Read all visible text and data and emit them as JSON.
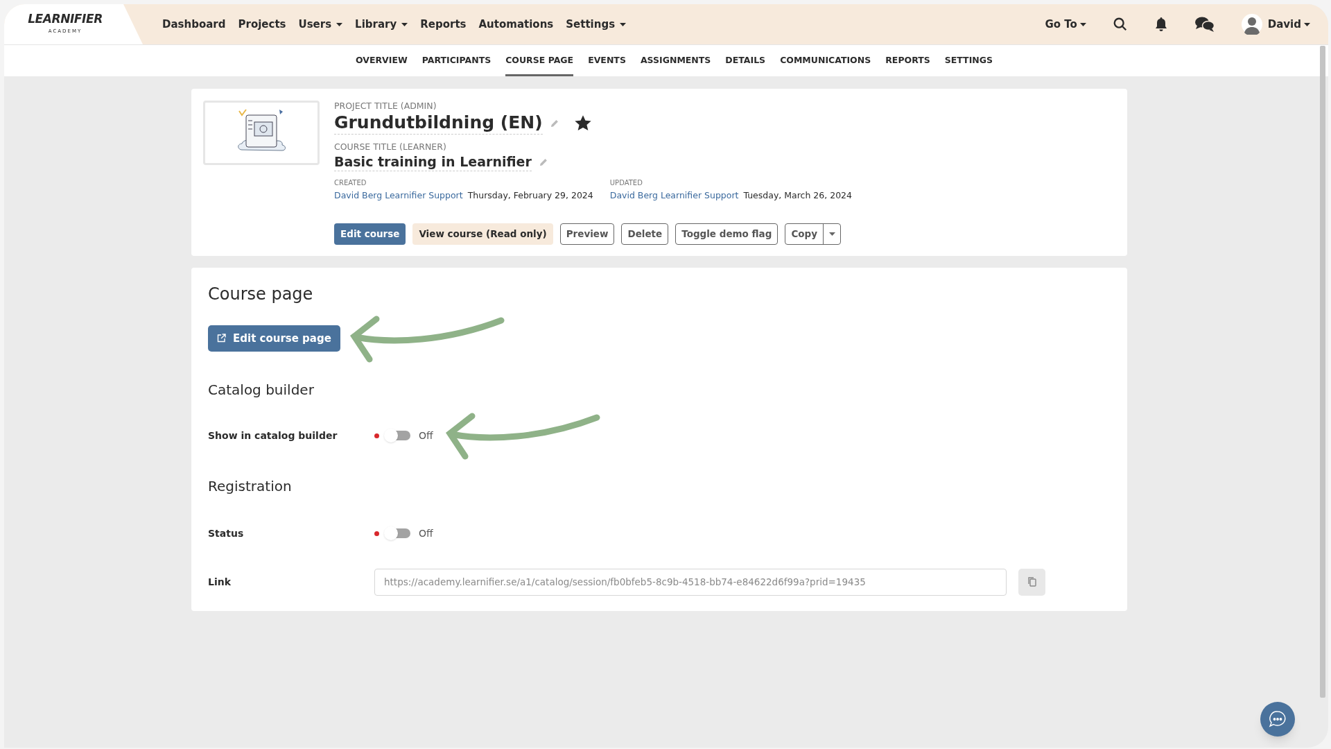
{
  "nav": {
    "logo": {
      "name": "LEARNIFIER",
      "tagline": "ACADEMY"
    },
    "items": [
      {
        "label": "Dashboard",
        "dropdown": false
      },
      {
        "label": "Projects",
        "dropdown": false
      },
      {
        "label": "Users",
        "dropdown": true
      },
      {
        "label": "Library",
        "dropdown": true
      },
      {
        "label": "Reports",
        "dropdown": false
      },
      {
        "label": "Automations",
        "dropdown": false
      },
      {
        "label": "Settings",
        "dropdown": true
      }
    ],
    "goto": "Go To",
    "user": "David"
  },
  "tabs": [
    {
      "label": "OVERVIEW",
      "selected": false
    },
    {
      "label": "PARTICIPANTS",
      "selected": false
    },
    {
      "label": "COURSE PAGE",
      "selected": true
    },
    {
      "label": "EVENTS",
      "selected": false
    },
    {
      "label": "ASSIGNMENTS",
      "selected": false
    },
    {
      "label": "DETAILS",
      "selected": false
    },
    {
      "label": "COMMUNICATIONS",
      "selected": false
    },
    {
      "label": "REPORTS",
      "selected": false
    },
    {
      "label": "SETTINGS",
      "selected": false
    }
  ],
  "course": {
    "project_title_label": "PROJECT TITLE (ADMIN)",
    "project_title": "Grundutbildning (EN)",
    "starred": true,
    "course_title_label": "COURSE TITLE (LEARNER)",
    "course_title": "Basic training in Learnifier",
    "meta": [
      {
        "label": "CREATED",
        "by": "David Berg Learnifier Support",
        "date": "Thursday, February 29, 2024"
      },
      {
        "label": "UPDATED",
        "by": "David Berg Learnifier Support",
        "date": "Tuesday, March 26, 2024"
      }
    ],
    "buttons": [
      {
        "label": "Edit course",
        "kind": "primary"
      },
      {
        "label": "View course (Read only)",
        "kind": "soft"
      },
      {
        "label": "Preview",
        "kind": "outline"
      },
      {
        "label": "Delete",
        "kind": "outline"
      },
      {
        "label": "Toggle demo flag",
        "kind": "outline"
      },
      {
        "label": "Copy",
        "kind": "split"
      }
    ]
  },
  "course_page": {
    "heading": "Course page",
    "edit_button": "Edit course page"
  },
  "catalog_builder": {
    "heading": "Catalog builder",
    "setting": {
      "label": "Show in catalog builder",
      "on": false,
      "state_text": "Off"
    }
  },
  "registration": {
    "heading": "Registration",
    "status": {
      "label": "Status",
      "on": false,
      "state_text": "Off"
    },
    "link": {
      "label": "Link",
      "value": "https://academy.learnifier.se/a1/catalog/session/fb0bfeb5-8c9b-4518-bb74-e84622d6f99a?prid=19435"
    }
  }
}
